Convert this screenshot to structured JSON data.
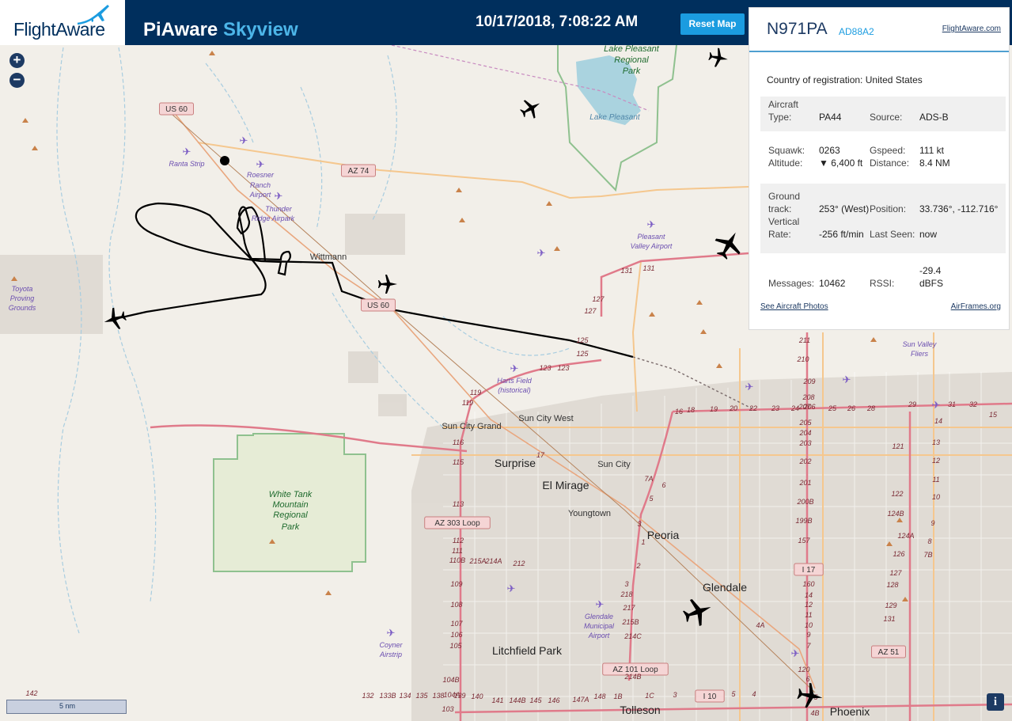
{
  "header": {
    "logo_text": "FlightAware",
    "app_title_part1": "PiAware",
    "app_title_part2": "Skyview",
    "timestamp": "10/17/2018, 7:08:22 AM",
    "reset_label": "Reset Map"
  },
  "map": {
    "zoom_in": "+",
    "zoom_out": "−",
    "scale_label": "5 nm",
    "info_label": "i",
    "places": [
      {
        "text": "Lake Pleasant",
        "kind": "park"
      },
      {
        "text": "Regional",
        "kind": "park"
      },
      {
        "text": "Park",
        "kind": "park"
      },
      {
        "text": "Lake Pleasant",
        "kind": "water"
      },
      {
        "text": "Ranta Strip",
        "kind": "airport"
      },
      {
        "text": "Roesner",
        "kind": "airport"
      },
      {
        "text": "Ranch",
        "kind": "airport"
      },
      {
        "text": "Airport",
        "kind": "airport"
      },
      {
        "text": "Thunder",
        "kind": "airport"
      },
      {
        "text": "Ridge Airpark",
        "kind": "airport"
      },
      {
        "text": "Wittmann",
        "kind": "town"
      },
      {
        "text": "Toyota",
        "kind": "airport"
      },
      {
        "text": "Proving",
        "kind": "airport"
      },
      {
        "text": "Grounds",
        "kind": "airport"
      },
      {
        "text": "Pleasant",
        "kind": "airport"
      },
      {
        "text": "Valley Airport",
        "kind": "airport"
      },
      {
        "text": "Harts Field",
        "kind": "airport"
      },
      {
        "text": "(historical)",
        "kind": "airport"
      },
      {
        "text": "Sun Valley",
        "kind": "airport"
      },
      {
        "text": "Fliers",
        "kind": "airport"
      },
      {
        "text": "Sun City Grand",
        "kind": "town"
      },
      {
        "text": "Sun City West",
        "kind": "town"
      },
      {
        "text": "Surprise",
        "kind": "city"
      },
      {
        "text": "Sun City",
        "kind": "town"
      },
      {
        "text": "El Mirage",
        "kind": "city"
      },
      {
        "text": "Youngtown",
        "kind": "town"
      },
      {
        "text": "Peoria",
        "kind": "city"
      },
      {
        "text": "Glendale",
        "kind": "city"
      },
      {
        "text": "White Tank",
        "kind": "park"
      },
      {
        "text": "Mountain",
        "kind": "park"
      },
      {
        "text": "Regional",
        "kind": "park"
      },
      {
        "text": "Park",
        "kind": "park"
      },
      {
        "text": "Glendale",
        "kind": "airport"
      },
      {
        "text": "Municipal",
        "kind": "airport"
      },
      {
        "text": "Airport",
        "kind": "airport"
      },
      {
        "text": "Coyner",
        "kind": "airport"
      },
      {
        "text": "Airstrip",
        "kind": "airport"
      },
      {
        "text": "Litchfield Park",
        "kind": "city"
      },
      {
        "text": "Tolleson",
        "kind": "city"
      },
      {
        "text": "Phoenix",
        "kind": "city"
      }
    ],
    "shields": [
      "US 60",
      "AZ 74",
      "US 60",
      "AZ 303 Loop",
      "AZ 101 Loop",
      "I 17",
      "AZ 51",
      "I 10"
    ],
    "exits": [
      "127",
      "127",
      "131",
      "131",
      "125",
      "125",
      "123",
      "123",
      "119",
      "119",
      "116",
      "115",
      "113",
      "112",
      "111",
      "110B",
      "109",
      "108",
      "107",
      "106",
      "105",
      "104B",
      "104A",
      "103",
      "142",
      "17",
      "16",
      "18",
      "19",
      "20",
      "22",
      "23",
      "24",
      "25",
      "26",
      "28",
      "29",
      "31",
      "32",
      "15",
      "14",
      "13",
      "12",
      "11",
      "10",
      "9",
      "8",
      "7B",
      "7A",
      "6",
      "5",
      "3",
      "1",
      "2",
      "3",
      "218",
      "217",
      "215B",
      "214C",
      "214B",
      "215A",
      "214A",
      "212",
      "211",
      "210",
      "209",
      "208",
      "207",
      "206",
      "205",
      "204",
      "203",
      "202",
      "201",
      "200B",
      "199B",
      "157",
      "160",
      "14",
      "12",
      "11",
      "10",
      "9",
      "7",
      "6",
      "5",
      "4B",
      "4A",
      "120",
      "121",
      "122",
      "124B",
      "124A",
      "126",
      "127",
      "128",
      "129",
      "131",
      "132",
      "133B",
      "134",
      "135",
      "138",
      "139",
      "140",
      "141",
      "144B",
      "145",
      "146",
      "147A",
      "148",
      "1B",
      "1C",
      "3",
      "5",
      "4"
    ]
  },
  "aircraft_panel": {
    "callsign": "N971PA",
    "icao": "AD88A2",
    "flightaware_link": "FlightAware.com",
    "country_label": "Country of registration:",
    "country_value": "United States",
    "type_label_1": "Aircraft",
    "type_label_2": "Type:",
    "type_value": "PA44",
    "source_label": "Source:",
    "source_value": "ADS-B",
    "squawk_label": "Squawk:",
    "squawk_value": "0263",
    "gspeed_label": "Gspeed:",
    "gspeed_value": "111 kt",
    "altitude_label": "Altitude:",
    "altitude_value": "▼ 6,400 ft",
    "distance_label": "Distance:",
    "distance_value": "8.4 NM",
    "track_label_1": "Ground",
    "track_label_2": "track:",
    "track_value": "253° (West)",
    "position_label": "Position:",
    "position_value": "33.736°, -112.716°",
    "vrate_label_1": "Vertical",
    "vrate_label_2": "Rate:",
    "vrate_value": "-256 ft/min",
    "lastseen_label": "Last Seen:",
    "lastseen_value": "now",
    "messages_label": "Messages:",
    "messages_value": "10462",
    "rssi_label": "RSSI:",
    "rssi_value_1": "-29.4",
    "rssi_value_2": "dBFS",
    "photos_link": "See Aircraft Photos",
    "airframes_link": "AirFrames.org"
  },
  "colors": {
    "header_bg": "#002f5d",
    "accent": "#1b9ce0",
    "track": "#000000",
    "highway": "#e07a8a",
    "arterial": "#f5c78e",
    "park_border": "#8fc18f",
    "water": "#aad3df",
    "urban": "#d9d4cc"
  }
}
